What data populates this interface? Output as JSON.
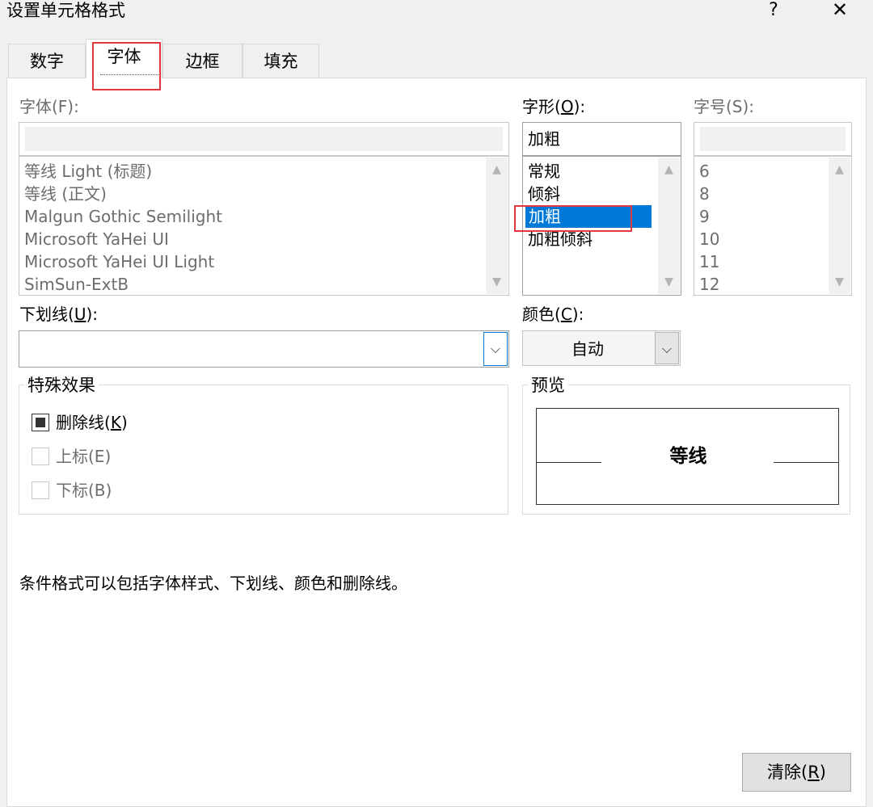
{
  "window": {
    "title": "设置单元格格式",
    "help_label": "?",
    "close_label": "✕"
  },
  "tabs": [
    {
      "label": "数字",
      "active": false
    },
    {
      "label": "字体",
      "active": true
    },
    {
      "label": "边框",
      "active": false
    },
    {
      "label": "填充",
      "active": false
    }
  ],
  "font": {
    "label": "字体(F):",
    "value": "",
    "items": [
      "等线 Light (标题)",
      "等线 (正文)",
      "Malgun Gothic Semilight",
      "Microsoft YaHei UI",
      "Microsoft YaHei UI Light",
      "SimSun-ExtB"
    ]
  },
  "style": {
    "label_pre": "字形(",
    "label_key": "O",
    "label_post": "):",
    "value": "加粗",
    "items": [
      "常规",
      "倾斜",
      "加粗",
      "加粗倾斜"
    ],
    "selected": "加粗"
  },
  "size": {
    "label": "字号(S):",
    "value": "",
    "items": [
      "6",
      "8",
      "9",
      "10",
      "11",
      "12"
    ]
  },
  "underline": {
    "label_pre": "下划线(",
    "label_key": "U",
    "label_post": "):",
    "value": ""
  },
  "color": {
    "label_pre": "颜色(",
    "label_key": "C",
    "label_post": "):",
    "value": "自动"
  },
  "effects": {
    "title": "特殊效果",
    "strikethrough": {
      "label_pre": "删除线(",
      "label_key": "K",
      "label_post": ")",
      "state": "indeterminate",
      "enabled": true
    },
    "superscript": {
      "label": "上标(E)",
      "checked": false,
      "enabled": false
    },
    "subscript": {
      "label": "下标(B)",
      "checked": false,
      "enabled": false
    }
  },
  "preview": {
    "title": "预览",
    "sample_text": "等线"
  },
  "note": "条件格式可以包括字体样式、下划线、颜色和删除线。",
  "clear_button": {
    "label_pre": "清除(",
    "label_key": "R",
    "label_post": ")"
  },
  "icons": {
    "scroll_up": "▲",
    "scroll_down": "▼",
    "dropdown": "⌵"
  }
}
